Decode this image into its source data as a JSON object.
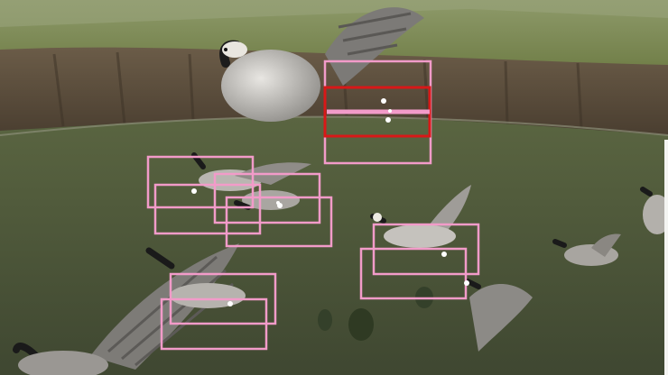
{
  "scene": {
    "subject": "geese-in-flight",
    "colors": {
      "box_default": "#f29bc9",
      "box_selected": "#d81818",
      "keypoint": "#ffffff",
      "sky_haze": "#a9b08f",
      "hill_top": "#7a8a52",
      "cliff": "#5b4e3d",
      "valley": "#4b5438"
    }
  },
  "annotations": {
    "box_count": 12,
    "selected_box_index": 1,
    "keypoint_count": 9
  }
}
